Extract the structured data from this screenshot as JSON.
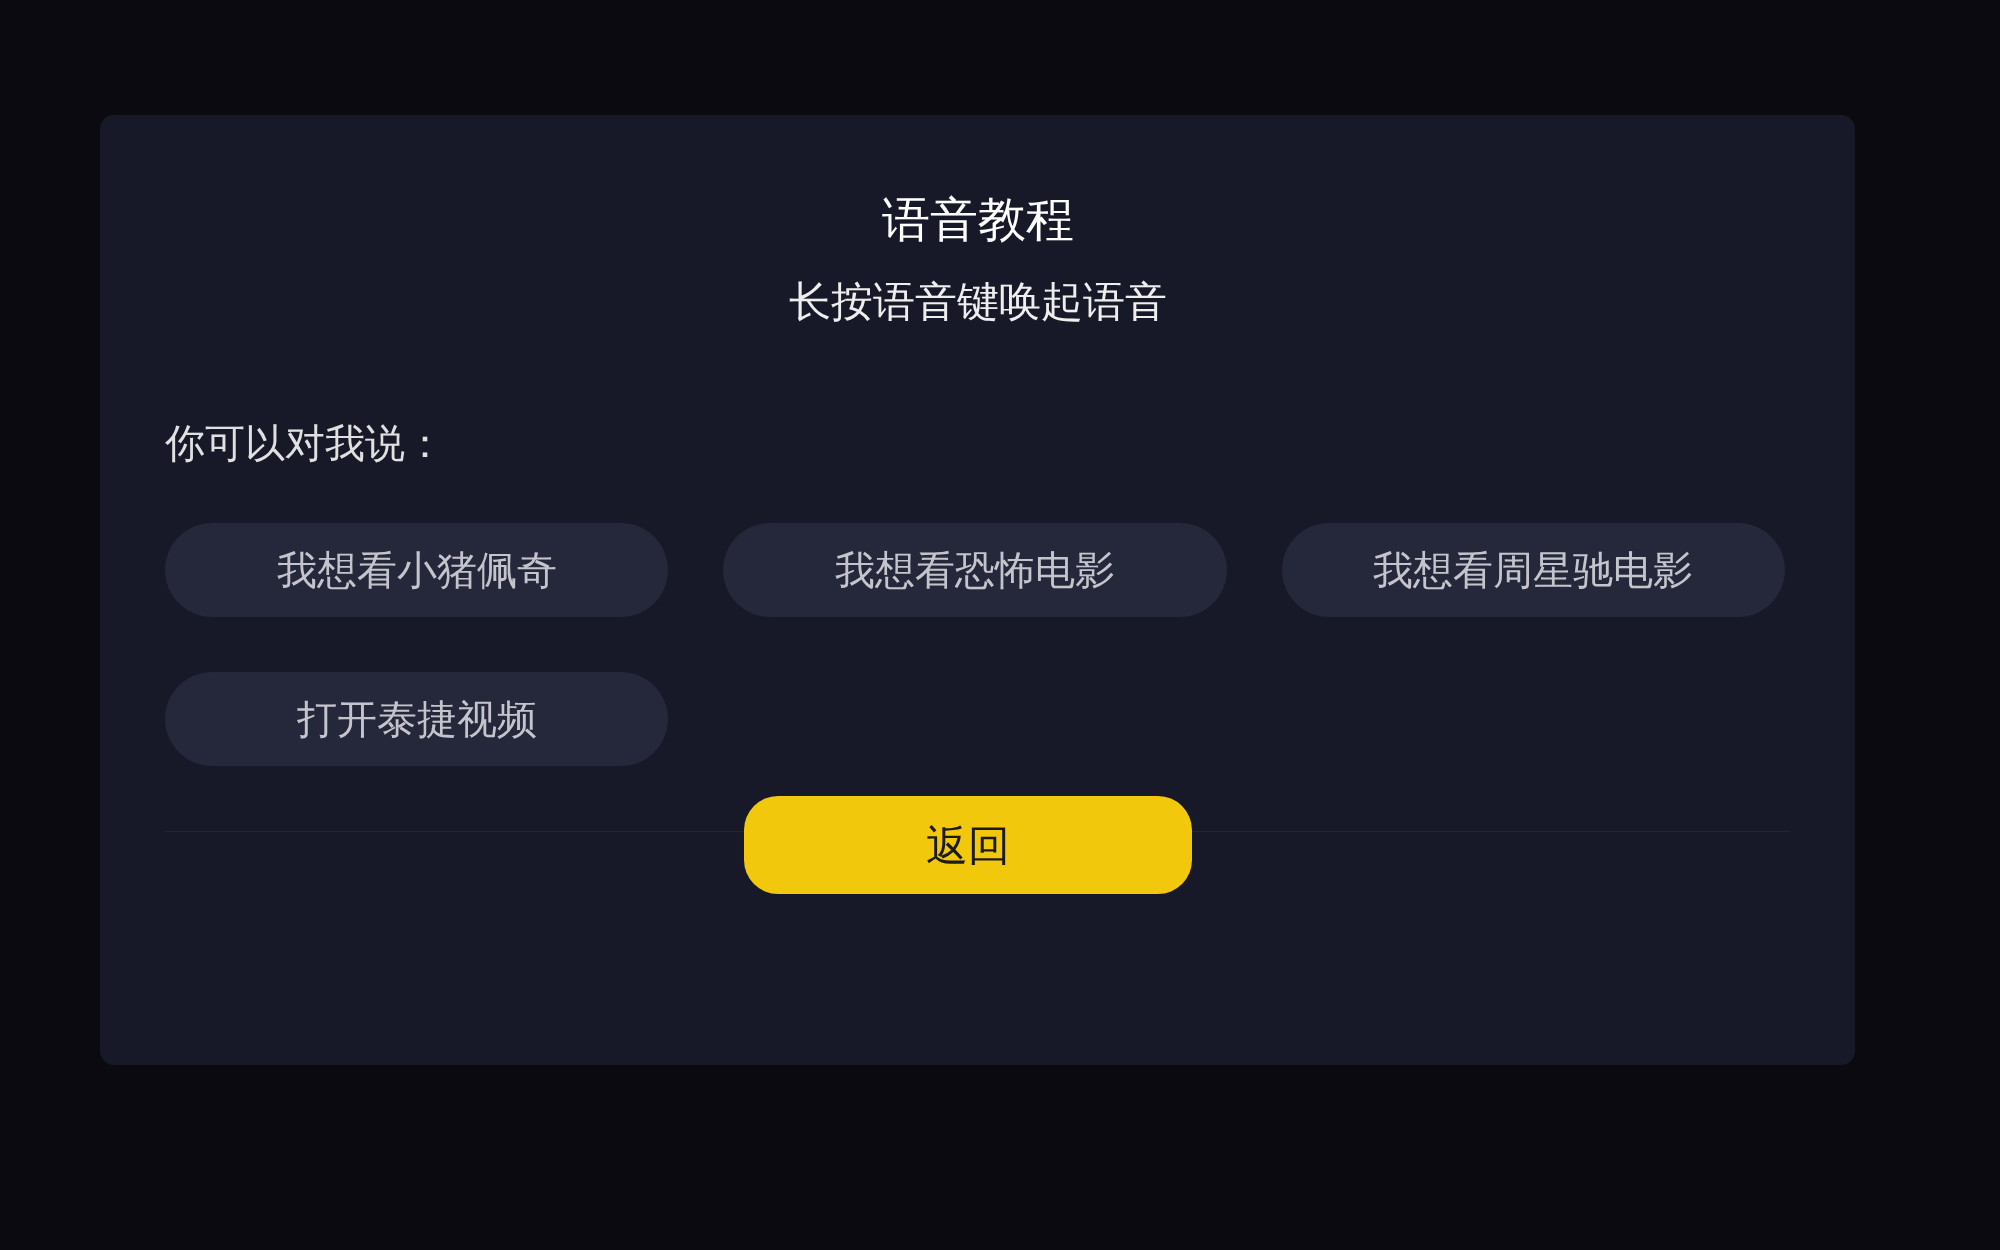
{
  "dialog": {
    "title": "语音教程",
    "subtitle": "长按语音键唤起语音",
    "prompt": "你可以对我说：",
    "suggestions": [
      {
        "label": "我想看小猪佩奇"
      },
      {
        "label": "我想看恐怖电影"
      },
      {
        "label": "我想看周星驰电影"
      },
      {
        "label": "打开泰捷视频"
      }
    ],
    "back_button": "返回"
  }
}
